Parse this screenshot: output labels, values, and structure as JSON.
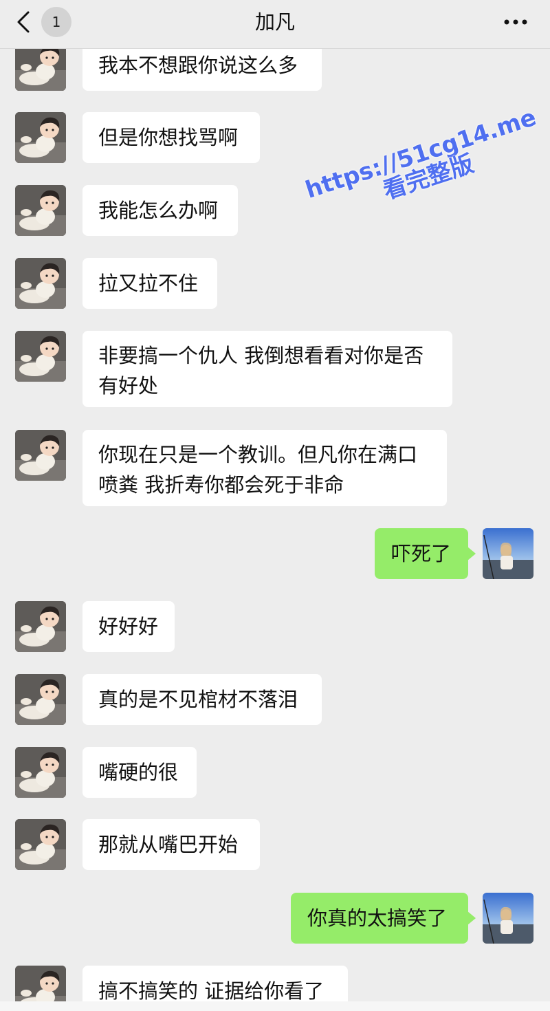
{
  "header": {
    "title": "加凡",
    "unread_count": "1"
  },
  "watermark": {
    "url": "https://51cg14.me",
    "text": "看完整版",
    "color": "#4f6ff0"
  },
  "messages": [
    {
      "side": "left",
      "text": "我本不想跟你说这么多"
    },
    {
      "side": "left",
      "text": "但是你想找骂啊"
    },
    {
      "side": "left",
      "text": "我能怎么办啊"
    },
    {
      "side": "left",
      "text": "拉又拉不住"
    },
    {
      "side": "left",
      "line1": "非要搞一个仇人 我倒想看看对你是否",
      "line2": "有好处"
    },
    {
      "side": "left",
      "line1": "你现在只是一个教训。但凡你在满口",
      "line2": "喷粪 我折寿你都会死于非命"
    },
    {
      "side": "right",
      "text": "吓死了"
    },
    {
      "side": "left",
      "text": "好好好"
    },
    {
      "side": "left",
      "text": "真的是不见棺材不落泪"
    },
    {
      "side": "left",
      "text": "嘴硬的很"
    },
    {
      "side": "left",
      "text": "那就从嘴巴开始"
    },
    {
      "side": "right",
      "text": "你真的太搞笑了"
    },
    {
      "side": "left",
      "text": "搞不搞笑的 证据给你看了"
    }
  ],
  "colors": {
    "background": "#ededed",
    "incoming_bubble": "#ffffff",
    "outgoing_bubble": "#95ec69"
  }
}
